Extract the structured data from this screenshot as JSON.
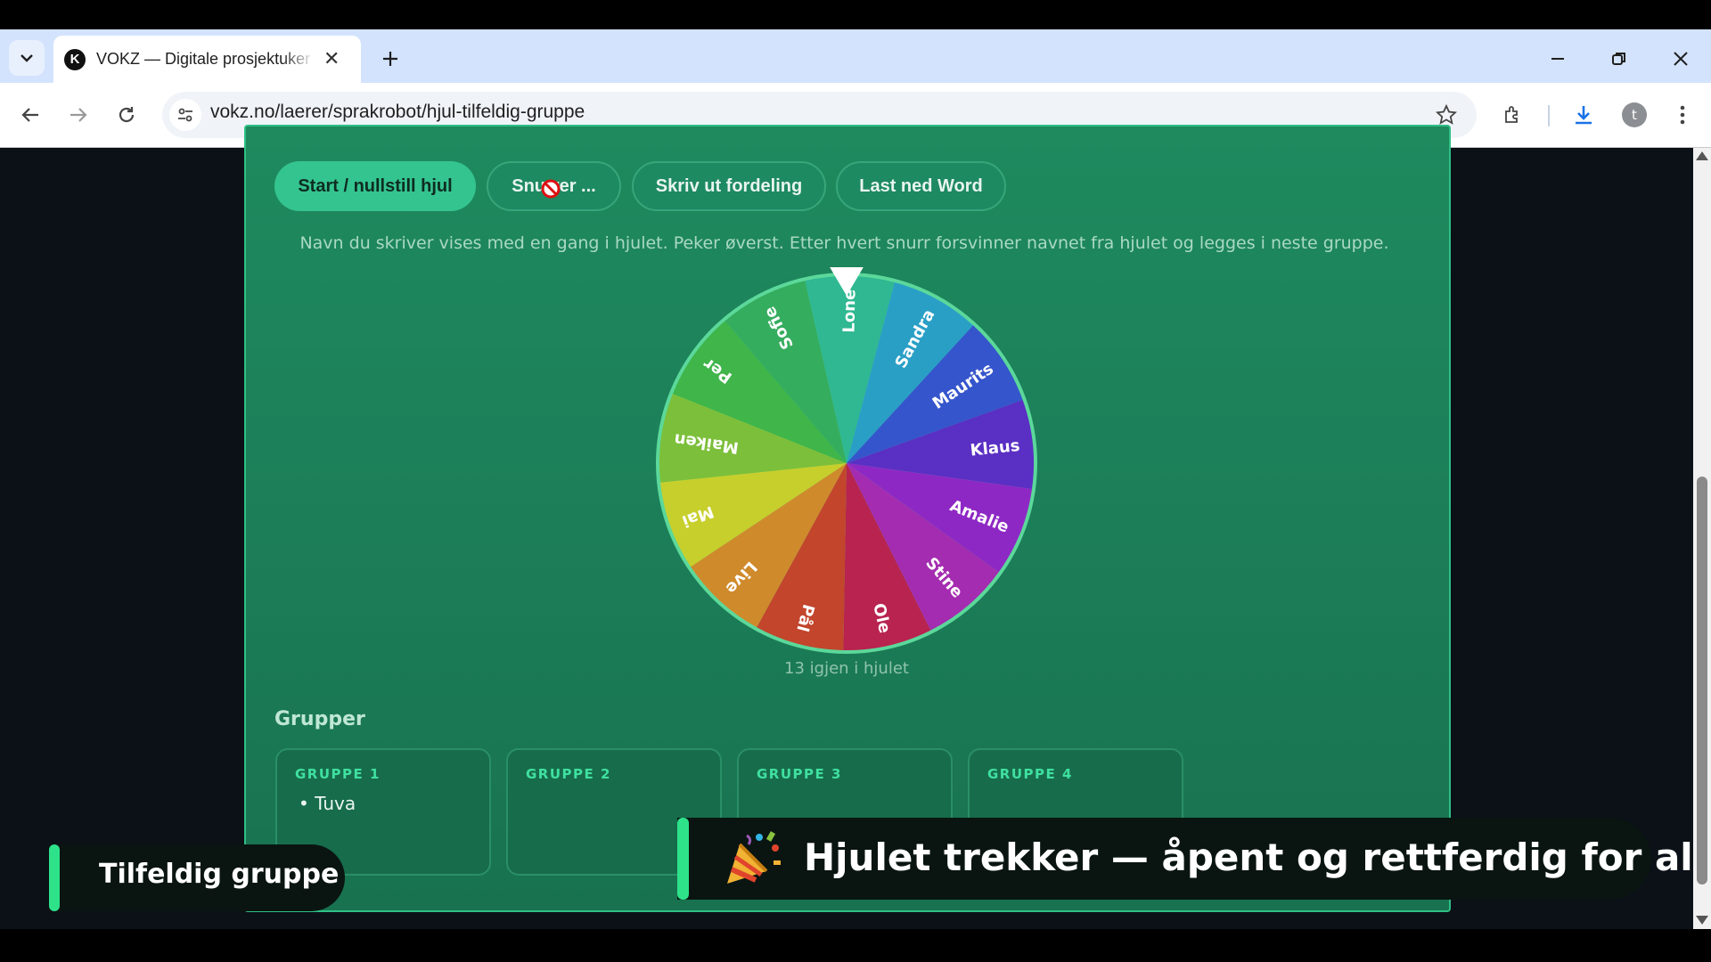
{
  "browser": {
    "tab_title": "VOKZ — Digitale prosjektuker og",
    "tab_favicon_letter": "K",
    "url": "vokz.no/laerer/sprakrobot/hjul-tilfeldig-gruppe",
    "profile_initial": "t",
    "icons": [
      "tab-search-icon",
      "close-icon",
      "plus-icon",
      "minimize-icon",
      "restore-icon",
      "back-icon",
      "forward-icon",
      "reload-icon",
      "site-info-icon",
      "star-icon",
      "extensions-icon",
      "download-icon",
      "menu-icon"
    ]
  },
  "toolbar": {
    "start_label": "Start / nullstill hjul",
    "spin_label": "Snurrer ...",
    "print_label": "Skriv ut fordeling",
    "word_label": "Last ned Word"
  },
  "hint": "Navn du skriver vises med en gang i hjulet. Peker øverst. Etter hvert snurr forsvinner navnet fra hjulet og legges i neste gruppe.",
  "wheel": {
    "names": [
      "Lone",
      "Sandra",
      "Maurits",
      "Klaus",
      "Amalie",
      "Stine",
      "Ole",
      "Pål",
      "Live",
      "Mai",
      "Maiken",
      "Per",
      "Sofie"
    ],
    "colors": [
      "#2fb891",
      "#2a9fc6",
      "#3555cc",
      "#5a2fc4",
      "#8e28c4",
      "#a42cb0",
      "#b8234f",
      "#c2452c",
      "#cf8a2c",
      "#c7cf2c",
      "#7cbf3a",
      "#3fb54a",
      "#35ad5e"
    ],
    "remaining_text": "13 igjen i hjulet"
  },
  "groups": {
    "heading": "Grupper",
    "items": [
      {
        "name": "GRUPPE 1",
        "members": [
          "Tuva"
        ]
      },
      {
        "name": "GRUPPE 2",
        "members": []
      },
      {
        "name": "GRUPPE 3",
        "members": []
      },
      {
        "name": "GRUPPE 4",
        "members": []
      }
    ]
  },
  "overlay": {
    "left_caption": "Tilfeldig gruppe",
    "right_caption": "Hjulet trekker — åpent og rettferdig for alle",
    "emoji_icon": "party-popper-icon"
  }
}
